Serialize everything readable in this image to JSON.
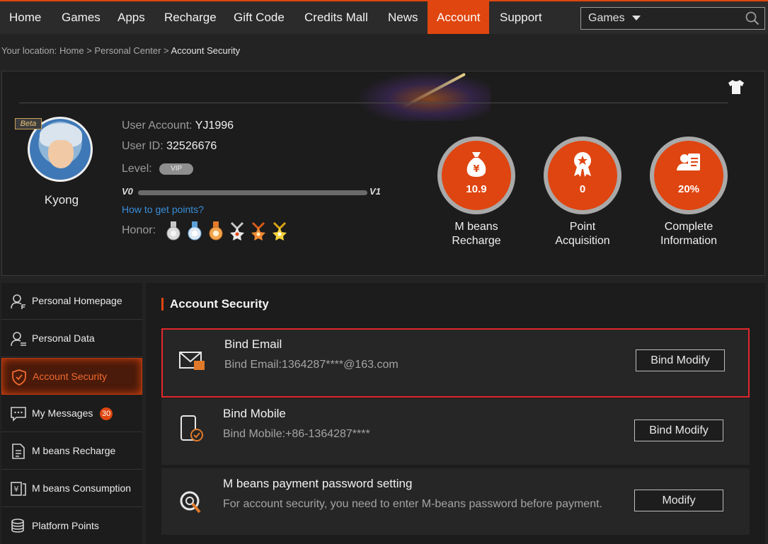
{
  "nav": {
    "items": [
      "Home",
      "Games",
      "Apps",
      "Recharge",
      "Gift Code",
      "Credits Mall",
      "News",
      "Account",
      "Support"
    ],
    "active": "Account",
    "search_select": "Games"
  },
  "breadcrumb": {
    "prefix": "Your location:",
    "home": "Home",
    "sep1": ">",
    "parent": "Personal Center",
    "sep2": ">",
    "current": "Account Security"
  },
  "profile": {
    "beta_tag": "Beta",
    "nickname": "Kyong",
    "account_label": "User Account:",
    "account_value": "YJ1996",
    "id_label": "User ID:",
    "id_value": "32526676",
    "level_label": "Level:",
    "vip_badge": "VIP",
    "level_start": "V0",
    "level_end": "V1",
    "level_progress": 0,
    "howto_link": "How to get points?",
    "honor_label": "Honor:"
  },
  "stats": [
    {
      "value": "10.9",
      "label_line1": "M beans",
      "label_line2": "Recharge"
    },
    {
      "value": "0",
      "label_line1": "Point",
      "label_line2": "Acquisition"
    },
    {
      "value": "20%",
      "label_line1": "Complete",
      "label_line2": "Information"
    }
  ],
  "sidebar": {
    "items": [
      {
        "label": "Personal Homepage"
      },
      {
        "label": "Personal Data"
      },
      {
        "label": "Account Security"
      },
      {
        "label": "My Messages",
        "badge": "30"
      },
      {
        "label": "M beans Recharge"
      },
      {
        "label": "M beans Consumption"
      },
      {
        "label": "Platform Points"
      }
    ],
    "active_index": 2
  },
  "content": {
    "title": "Account Security",
    "rows": [
      {
        "title": "Bind Email",
        "desc": "Bind Email:1364287****@163.com",
        "button": "Bind Modify"
      },
      {
        "title": "Bind Mobile",
        "desc": "Bind Mobile:+86-1364287****",
        "button": "Bind Modify"
      },
      {
        "title": "M beans payment password setting",
        "desc": "For account security, you need to enter M-beans password before payment.",
        "button": "Modify"
      }
    ]
  },
  "colors": {
    "accent": "#e0460f",
    "highlight_border": "#e2282a",
    "link": "#3a8ed8"
  }
}
